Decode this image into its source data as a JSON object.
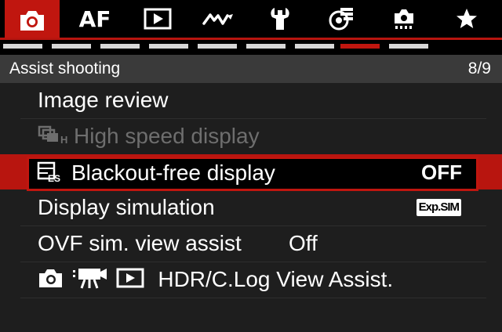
{
  "tabs": [
    {
      "name": "shooting",
      "icon": "camera-icon",
      "active": true
    },
    {
      "name": "af",
      "label": "AF"
    },
    {
      "name": "playback",
      "icon": "play-icon"
    },
    {
      "name": "wireless",
      "icon": "wireless-icon"
    },
    {
      "name": "setup",
      "icon": "wrench-icon"
    },
    {
      "name": "custom-functions",
      "icon": "custom-functions-icon"
    },
    {
      "name": "my-menu-camera",
      "icon": "camera-settings-icon"
    },
    {
      "name": "my-menu",
      "icon": "star-icon"
    }
  ],
  "page_indicator": {
    "total": 9,
    "current": 8
  },
  "section": {
    "title": "Assist shooting",
    "page": "8/9"
  },
  "menu": {
    "items": [
      {
        "label": "Image review"
      },
      {
        "label": "High speed display",
        "enabled": false
      },
      {
        "label": "Blackout-free display",
        "value": "OFF",
        "selected": true
      },
      {
        "label": "Display simulation",
        "badge": "Exp.SIM"
      },
      {
        "label": "OVF sim. view assist",
        "value": "Off"
      },
      {
        "label": "HDR/C.Log View Assist."
      }
    ]
  },
  "colors": {
    "accent": "#c0160f",
    "header_bg": "#3a3a3a",
    "menu_bg": "#1e1e1e"
  }
}
